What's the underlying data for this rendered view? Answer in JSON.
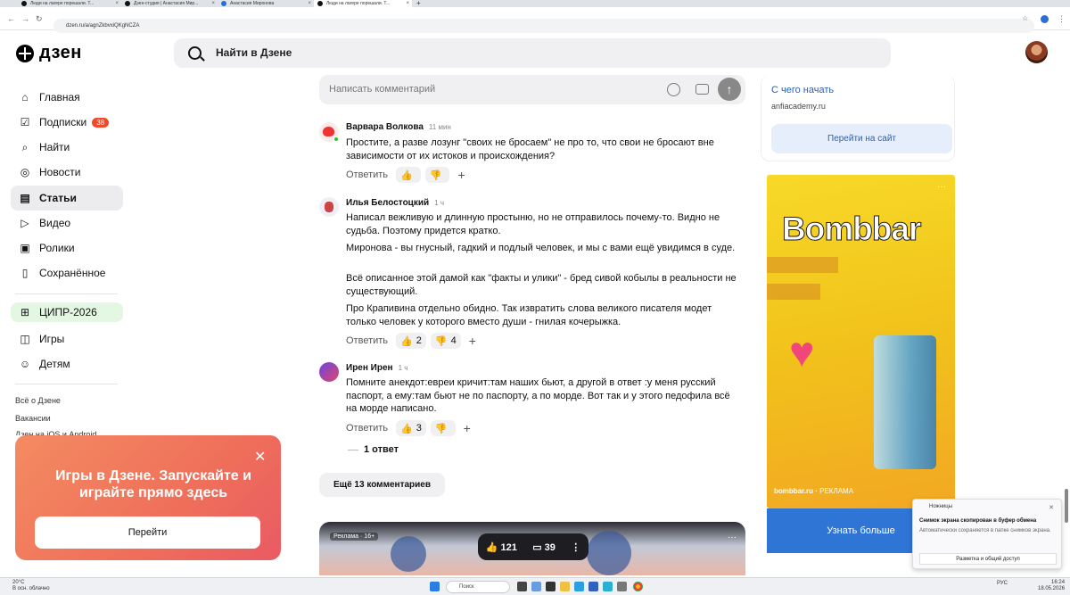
{
  "browser": {
    "tabs": [
      "Люди на лагере порешали. Т...",
      "Дзен-студия | Анастасия Мир...",
      "Анастасия Миронова",
      "Люди на лагере порешали. Т..."
    ],
    "url": "dzen.ru/a/agnZkbvxiQKgNCZA"
  },
  "header": {
    "logo": "дзен",
    "search_placeholder": "Найти в Дзене"
  },
  "sidebar": {
    "items": [
      {
        "label": "Главная",
        "icon": "home-icon"
      },
      {
        "label": "Подписки",
        "icon": "subscriptions-icon",
        "badge": "38"
      },
      {
        "label": "Найти",
        "icon": "search-icon"
      },
      {
        "label": "Новости",
        "icon": "news-icon"
      },
      {
        "label": "Статьи",
        "icon": "articles-icon"
      },
      {
        "label": "Видео",
        "icon": "video-icon"
      },
      {
        "label": "Ролики",
        "icon": "clips-icon"
      },
      {
        "label": "Сохранённое",
        "icon": "bookmark-icon"
      },
      {
        "label": "ЦИПР-2026",
        "icon": "chip-icon"
      },
      {
        "label": "Игры",
        "icon": "games-icon"
      },
      {
        "label": "Детям",
        "icon": "kids-icon"
      }
    ],
    "footer_links": [
      "Всё о Дзене",
      "Вакансии",
      "Дзен на iOS и Android"
    ]
  },
  "promo": {
    "title": "Игры в Дзене. Запускайте и играйте прямо здесь",
    "button": "Перейти"
  },
  "comment_input": {
    "placeholder": "Написать комментарий"
  },
  "comments": [
    {
      "author": "Варвара Волкова",
      "time": "11 мин",
      "paragraphs": [
        "Простите, а разве лозунг \"своих не бросаем\" не про то, что свои не бросают вне зависимости от их истоков и происхождения?"
      ],
      "reply": "Ответить",
      "likes": "",
      "dislikes": ""
    },
    {
      "author": "Илья Белостоцкий",
      "time": "1 ч",
      "paragraphs": [
        "Написал вежливую и длинную простыню, но не отправилось почему-то. Видно не судьба. Поэтому придется кратко.",
        "Миронова - вы гнусный, гадкий и подлый человек, и мы с вами ещё увидимся в суде.",
        "Всё описанное этой дамой как \"факты и улики\" - бред сивой кобылы в реальности не существующий.",
        "Про Крапивина отдельно обидно. Так извратить слова великого писателя модет только человек у которого вместо души - гнилая кочерыжка."
      ],
      "reply": "Ответить",
      "likes": "2",
      "dislikes": "4"
    },
    {
      "author": "Ирен Ирен",
      "time": "1 ч",
      "paragraphs": [
        "Помните анекдот:евреи кричит:там наших бьют, а другой в ответ :у меня русский паспорт, а ему:там бьют не по паспорту, а по морде. Вот так и у этого педофила всё на морде написано."
      ],
      "reply": "Ответить",
      "likes": "3",
      "dislikes": "",
      "replies_label": "1 ответ"
    }
  ],
  "more_comments": "Ещё 13 комментариев",
  "bottom_ad": {
    "label": "Реклама · 16+",
    "likes": "121",
    "comments": "39"
  },
  "right_column": {
    "link": "С чего начать",
    "site": "anfiacademy.ru",
    "button": "Перейти на сайт",
    "ad_brand_a": "Bomb",
    "ad_brand_b": "bar",
    "ad_domain": "bombbar.ru",
    "ad_tag": "РЕКЛАМА",
    "ad_button": "Узнать больше"
  },
  "toast": {
    "app": "Ножницы",
    "title": "Снимок экрана скопирован в буфер обмена",
    "body": "Автоматически сохраняется в папке снимков экрана.",
    "button": "Разметка и общий доступ"
  },
  "taskbar": {
    "weather_temp": "20°C",
    "weather_desc": "В осн. облачно",
    "search": "Поиск",
    "lang": "РУС",
    "time": "16:24",
    "date": "18.05.2026"
  }
}
